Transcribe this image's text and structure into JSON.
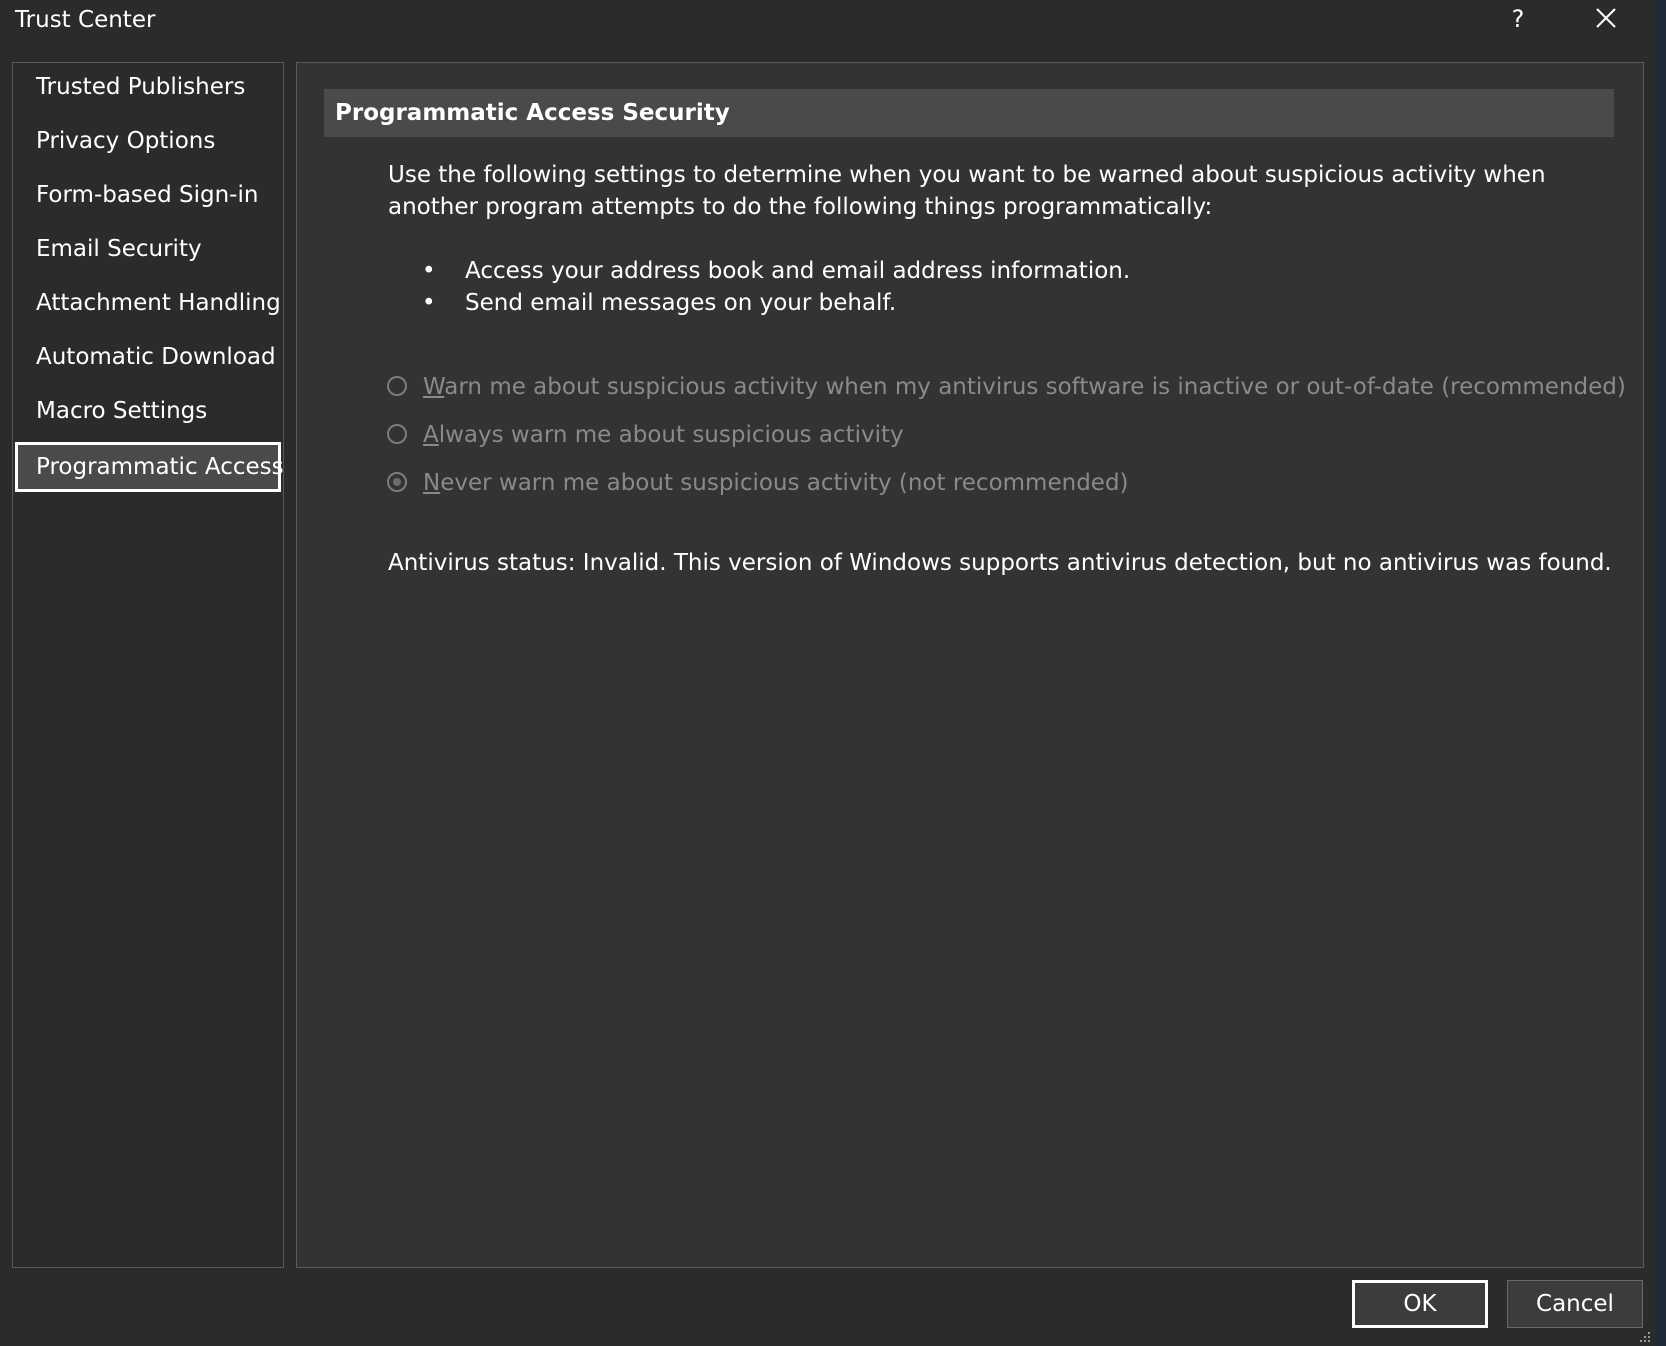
{
  "window": {
    "title": "Trust Center",
    "help_label": "?"
  },
  "nav": {
    "items": [
      {
        "label": "Trusted Publishers",
        "selected": false
      },
      {
        "label": "Privacy Options",
        "selected": false
      },
      {
        "label": "Form-based Sign-in",
        "selected": false
      },
      {
        "label": "Email Security",
        "selected": false
      },
      {
        "label": "Attachment Handling",
        "selected": false
      },
      {
        "label": "Automatic Download",
        "selected": false
      },
      {
        "label": "Macro Settings",
        "selected": false
      },
      {
        "label": "Programmatic Access",
        "selected": true
      }
    ]
  },
  "content": {
    "header": "Programmatic Access Security",
    "description": "Use the following settings to determine when you want to be warned about suspicious activity when another program attempts to do the following things programmatically:",
    "bullets": [
      "Access your address book and email address information.",
      "Send email messages on your behalf."
    ],
    "bullet_glyph": "•",
    "options": [
      {
        "label": "Warn me about suspicious activity when my antivirus software is inactive or out-of-date (recommended)",
        "checked": false,
        "enabled": false
      },
      {
        "label": "Always warn me about suspicious activity",
        "checked": false,
        "enabled": false
      },
      {
        "label": "Never warn me about suspicious activity (not recommended)",
        "checked": true,
        "enabled": false
      }
    ],
    "status": "Antivirus status: Invalid. This version of Windows supports antivirus detection, but no antivirus was found."
  },
  "buttons": {
    "ok": "OK",
    "cancel": "Cancel"
  },
  "colors": {
    "background": "#2b2b2b",
    "panel": "#333333",
    "header_bar": "#4a4a4a",
    "text": "#ffffff",
    "disabled_text": "#8a8a8a"
  }
}
